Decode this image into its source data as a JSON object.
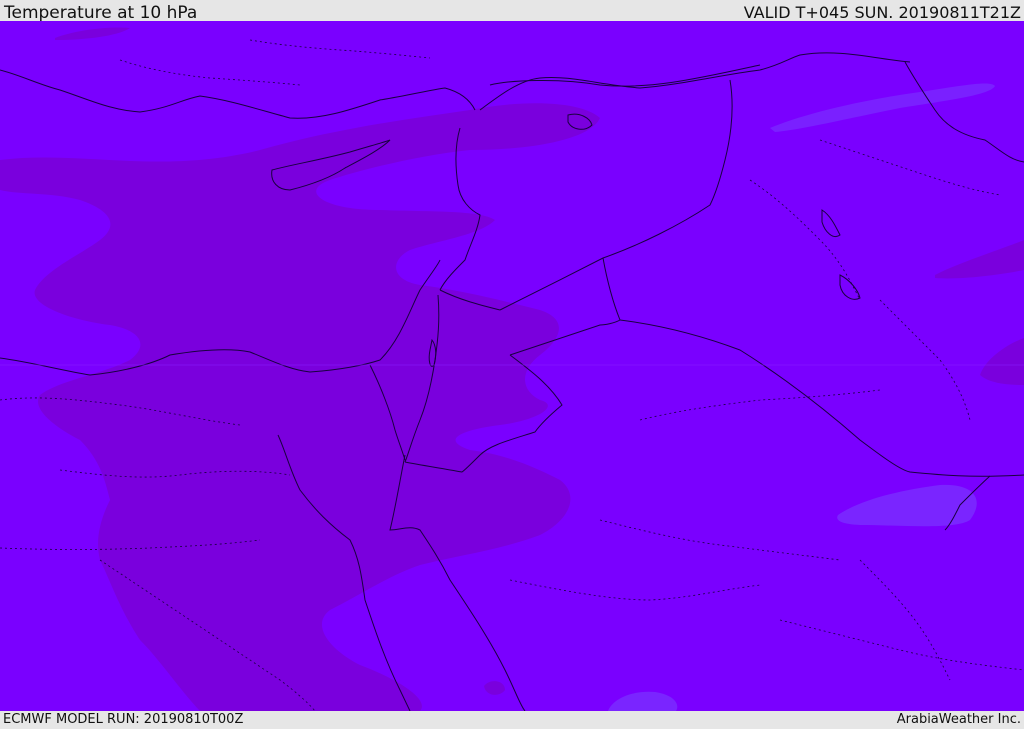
{
  "header": {
    "title": "Temperature at 10 hPa",
    "valid_time": "VALID T+045 SUN. 20190811T21Z"
  },
  "footer": {
    "model_run": "ECMWF MODEL RUN: 20190810T00Z",
    "credit": "ArabiaWeather Inc."
  },
  "map": {
    "region": "Eastern Mediterranean / Middle East",
    "colors": {
      "background_field": "#7a00ff",
      "warmer_band": "#7a00dd",
      "cooler_patches": "#7a20ff",
      "borders": "#1a0040"
    }
  }
}
